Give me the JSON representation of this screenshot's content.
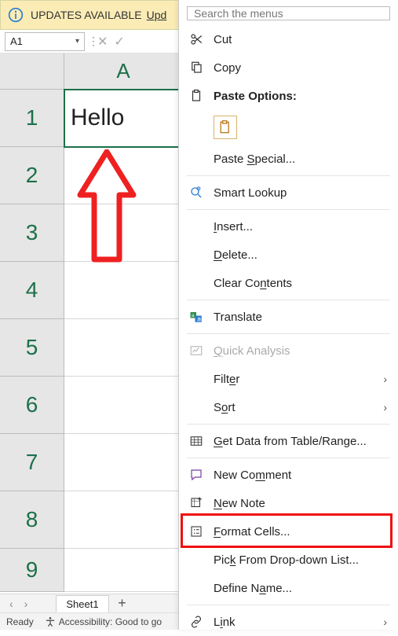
{
  "banner": {
    "text": "UPDATES AVAILABLE",
    "link": "Upd"
  },
  "namebox": "A1",
  "column_headers": [
    "A"
  ],
  "row_headers": [
    "1",
    "2",
    "3",
    "4",
    "5",
    "6",
    "7",
    "8",
    "9"
  ],
  "cells": {
    "A1": "Hello"
  },
  "sheet_tabs": [
    "Sheet1"
  ],
  "status": {
    "ready": "Ready",
    "accessibility": "Accessibility: Good to go"
  },
  "menu": {
    "search_placeholder": "Search the menus",
    "cut": "Cut",
    "copy": "Copy",
    "paste_options": "Paste Options:",
    "paste_special": "Paste Special...",
    "smart_lookup": "Smart Lookup",
    "insert": "Insert...",
    "delete": "Delete...",
    "clear_contents": "Clear Contents",
    "translate": "Translate",
    "quick_analysis": "Quick Analysis",
    "filter": "Filter",
    "sort": "Sort",
    "get_data": "Get Data from Table/Range...",
    "new_comment": "New Comment",
    "new_note": "New Note",
    "format_cells": "Format Cells...",
    "pick_list": "Pick From Drop-down List...",
    "define_name": "Define Name...",
    "link": "Link"
  }
}
